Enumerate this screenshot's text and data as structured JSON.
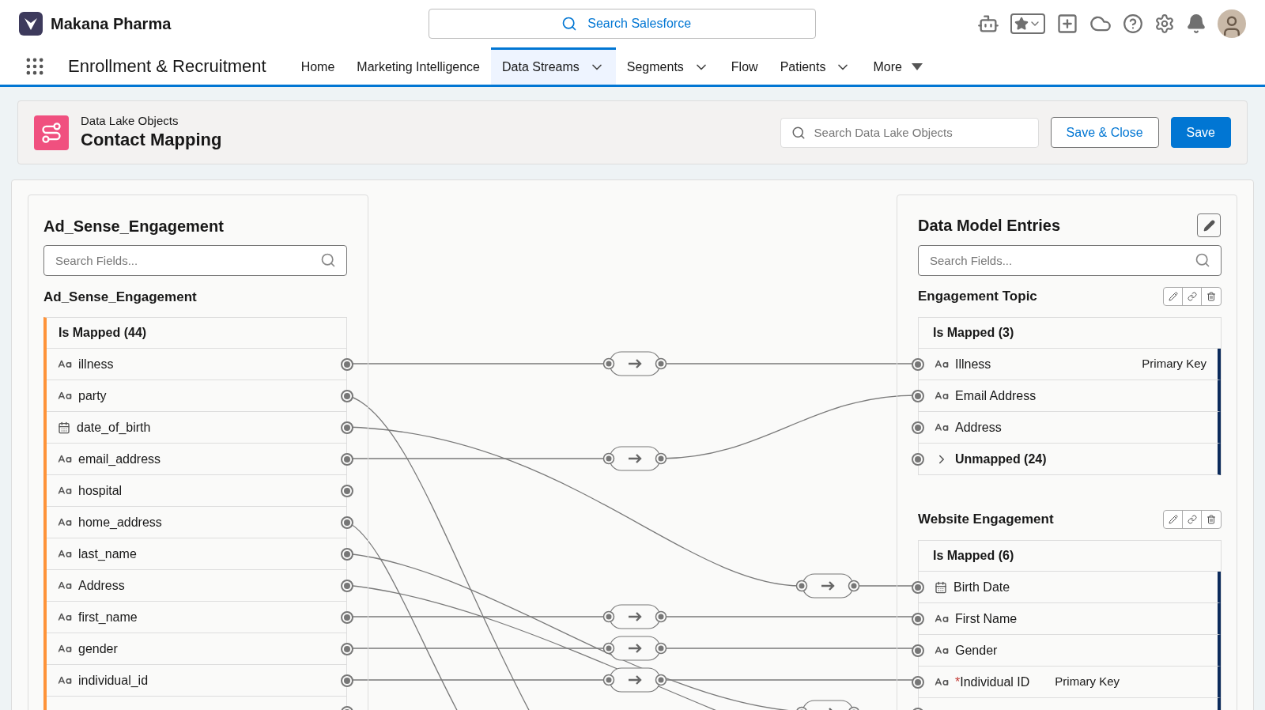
{
  "app": {
    "org_name": "Makana Pharma",
    "search_placeholder": "Search Salesforce"
  },
  "nav": {
    "app_name": "Enrollment & Recruitment",
    "tabs": [
      {
        "label": "Home",
        "selected": false,
        "kind": "plain"
      },
      {
        "label": "Marketing Intelligence",
        "selected": false,
        "kind": "plain"
      },
      {
        "label": "Data Streams",
        "selected": true,
        "kind": "menu"
      },
      {
        "label": "Segments",
        "selected": false,
        "kind": "menu"
      },
      {
        "label": "Flow",
        "selected": false,
        "kind": "plain"
      },
      {
        "label": "Patients",
        "selected": false,
        "kind": "menu"
      },
      {
        "label": "More",
        "selected": false,
        "kind": "overflow"
      }
    ]
  },
  "page_header": {
    "subtitle": "Data Lake Objects",
    "title": "Contact Mapping",
    "search_placeholder": "Search Data Lake Objects",
    "buttons": [
      {
        "label": "Save & Close",
        "kind": "outline"
      },
      {
        "label": "Save",
        "kind": "brand"
      }
    ]
  },
  "source_panel": {
    "title": "Ad_Sense_Engagement",
    "search_placeholder": "Search Fields...",
    "object_name": "Ad_Sense_Engagement",
    "group_label": "Is Mapped (44)",
    "fields": [
      {
        "name": "illness",
        "kind": "text"
      },
      {
        "name": "party",
        "kind": "text"
      },
      {
        "name": "date_of_birth",
        "kind": "date"
      },
      {
        "name": "email_address",
        "kind": "text"
      },
      {
        "name": "hospital",
        "kind": "text"
      },
      {
        "name": "home_address",
        "kind": "text"
      },
      {
        "name": "last_name",
        "kind": "text"
      },
      {
        "name": "Address",
        "kind": "text"
      },
      {
        "name": "first_name",
        "kind": "text"
      },
      {
        "name": "gender",
        "kind": "text"
      },
      {
        "name": "individual_id",
        "kind": "text"
      }
    ]
  },
  "target_panel": {
    "title": "Data Model Entries",
    "search_placeholder": "Search Fields...",
    "objects": [
      {
        "name": "Engagement Topic",
        "group_label": "Is Mapped (3)",
        "fields": [
          {
            "name": "Illness",
            "kind": "text",
            "key_label": "Primary Key"
          },
          {
            "name": "Email Address",
            "kind": "text"
          },
          {
            "name": "Address",
            "kind": "text"
          }
        ],
        "unmapped": {
          "label": "Unmapped (24)",
          "expanded": false
        }
      },
      {
        "name": "Website Engagement",
        "group_label": "Is Mapped (6)",
        "fields": [
          {
            "name": "Birth Date",
            "kind": "date"
          },
          {
            "name": "First Name",
            "kind": "text"
          },
          {
            "name": "Gender",
            "kind": "text"
          },
          {
            "name": "Individual ID",
            "kind": "text",
            "required_mark": "*",
            "key_label": "Primary Key"
          }
        ]
      }
    ]
  }
}
